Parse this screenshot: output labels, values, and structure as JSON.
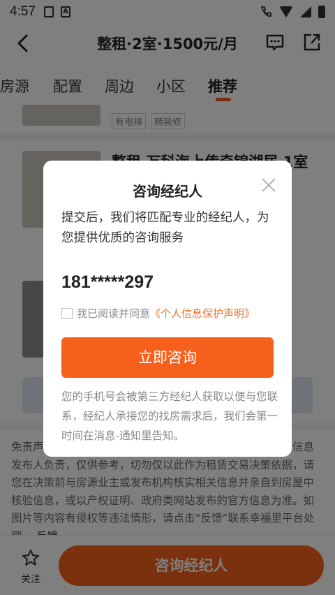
{
  "status_bar": {
    "time": "4:57",
    "icon1": "clipboard-icon",
    "icon2": "a-icon"
  },
  "nav": {
    "title": "整租·2室·1500元/月"
  },
  "tabs": [
    {
      "label": "房源"
    },
    {
      "label": "配置"
    },
    {
      "label": "周边"
    },
    {
      "label": "小区"
    },
    {
      "label": "推荐"
    }
  ],
  "listing": {
    "tags": [
      "有电梯",
      "精装修"
    ],
    "title": "整租 万科海上传奇锦湖居 1室"
  },
  "disclaimer": {
    "text": "免责声明：房源信息由网站用户提供，其真实性、合法性由信息发布人负责，仅供参考，切勿仅以此作为租赁交易决策依据，请您在决策前与房源业主或发布机构核实相关信息并亲自到房屋中核验信息，或以产权证明、政府类网站发布的官方信息为准。如图片等内容有侵权等违法情形，请点击“反馈”联系幸福里平台处理。",
    "link": "反馈"
  },
  "bottom": {
    "follow_label": "关注",
    "consult_label": "咨询经纪人"
  },
  "modal": {
    "title": "咨询经纪人",
    "desc": "提交后，我们将匹配专业的经纪人，为您提供优质的咨询服务",
    "phone": "181*****297",
    "agree_text": "我已阅读并同意",
    "agree_link": "《个人信息保护声明》",
    "button": "立即咨询",
    "note": "您的手机号会被第三方经纪人获取以便与您联系，经纪人承接您的找房需求后，我们会第一时间在消息-通知里告知。"
  },
  "colors": {
    "accent": "#f7601c",
    "link": "#e8742a"
  }
}
